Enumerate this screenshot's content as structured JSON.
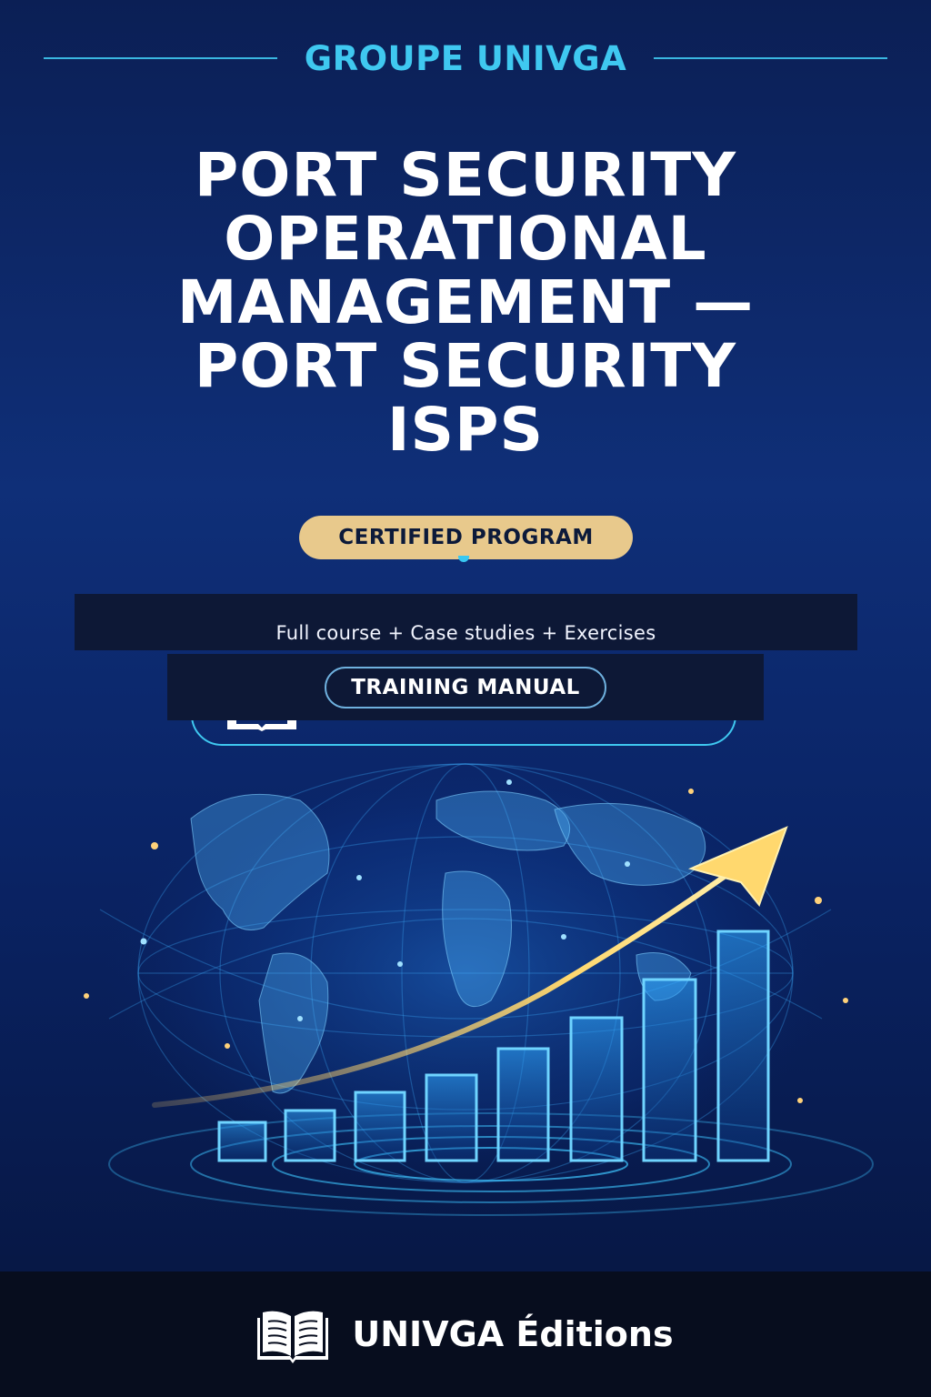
{
  "header": {
    "brand": "GROUPE UNIVGA",
    "accent_color": "#3fc8f0"
  },
  "title": {
    "lines": [
      "PORT SECURITY",
      "OPERATIONAL",
      "MANAGEMENT —",
      "PORT SECURITY",
      "ISPS"
    ]
  },
  "badges": {
    "certified": "CERTIFIED PROGRAM",
    "certified_color": "#e8c98c",
    "training": "TRAINING MANUAL"
  },
  "subtitle": "Full course + Case studies + Exercises",
  "illustration": {
    "icon": "globe-growth-chart-icon"
  },
  "footer": {
    "publisher": "UNIVGA Éditions",
    "icon": "open-book-icon"
  }
}
